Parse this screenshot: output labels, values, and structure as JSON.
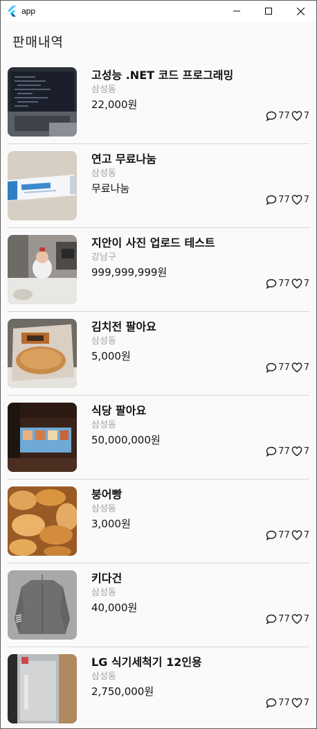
{
  "window": {
    "title": "app"
  },
  "page": {
    "title": "판매내역"
  },
  "items": [
    {
      "title": "고성능 .NET 코드 프로그래밍",
      "location": "삼성동",
      "price": "22,000원",
      "chats": "77",
      "likes": "7",
      "thumb": "laptop-photo"
    },
    {
      "title": "연고 무료나눔",
      "location": "삼성동",
      "price": "무료나눔",
      "chats": "77",
      "likes": "7",
      "thumb": "ointment-tube-photo"
    },
    {
      "title": "지안이 사진 업로드 테스트",
      "location": "강남구",
      "price": "999,999,999원",
      "chats": "77",
      "likes": "7",
      "thumb": "baby-photo"
    },
    {
      "title": "김치전 팔아요",
      "location": "삼성동",
      "price": "5,000원",
      "chats": "77",
      "likes": "7",
      "thumb": "kimchi-pancake-photo"
    },
    {
      "title": "식당 팔아요",
      "location": "삼성동",
      "price": "50,000,000원",
      "chats": "77",
      "likes": "7",
      "thumb": "restaurant-photo"
    },
    {
      "title": "붕어빵",
      "location": "삼성동",
      "price": "3,000원",
      "chats": "77",
      "likes": "7",
      "thumb": "fish-bread-photo"
    },
    {
      "title": "키다건",
      "location": "삼성동",
      "price": "40,000원",
      "chats": "77",
      "likes": "7",
      "thumb": "cardigan-photo"
    },
    {
      "title": "LG 식기세척기 12인용",
      "location": "삼성동",
      "price": "2,750,000원",
      "chats": "77",
      "likes": "7",
      "thumb": "dishwasher-photo"
    }
  ]
}
